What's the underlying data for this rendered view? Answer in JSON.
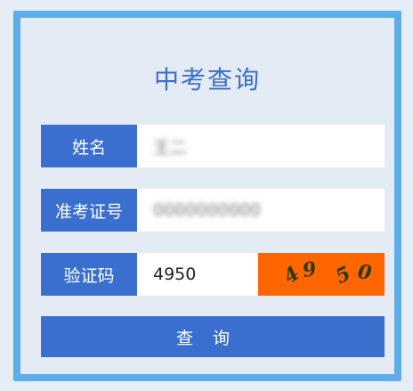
{
  "page": {
    "title": "中考查询"
  },
  "form": {
    "name": {
      "label": "姓名",
      "value": "王二"
    },
    "exam_id": {
      "label": "准考证号",
      "value": "0000000000"
    },
    "captcha": {
      "label": "验证码",
      "value": "4950",
      "image_chars": [
        "4",
        "9",
        "5",
        "0"
      ]
    }
  },
  "submit": {
    "label": "查询"
  },
  "colors": {
    "accent": "#3a6fd0",
    "frame_border": "#5dade8",
    "captcha_bg": "#ff6600",
    "title": "#3a6fc8"
  }
}
